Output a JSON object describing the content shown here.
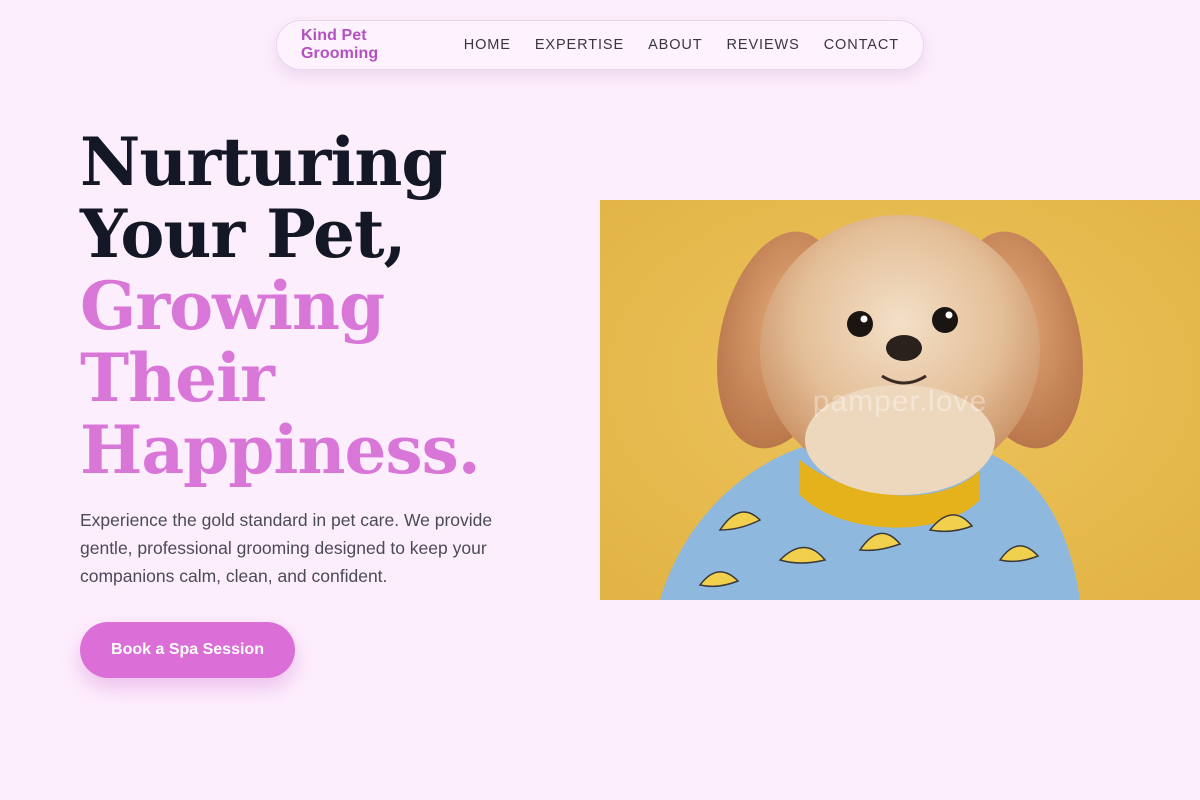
{
  "nav": {
    "brand": "Kind Pet Grooming",
    "links": [
      {
        "label": "HOME"
      },
      {
        "label": "EXPERTISE"
      },
      {
        "label": "ABOUT"
      },
      {
        "label": "REVIEWS"
      },
      {
        "label": "CONTACT"
      }
    ]
  },
  "hero": {
    "headline_line1": "Nurturing",
    "headline_line2": "Your Pet,",
    "headline_accent_line1": "Growing",
    "headline_accent_line2": "Their",
    "headline_accent_line3": "Happiness.",
    "description": "Experience the gold standard in pet care. We provide gentle, professional grooming designed to keep your companions calm, clean, and confident.",
    "cta_label": "Book a Spa Session",
    "image_watermark": "pamper.love"
  },
  "colors": {
    "background": "#fdeefd",
    "brand": "#b451c1",
    "accent": "#d977d8",
    "headline": "#141826",
    "image_background": "#e9bd52"
  }
}
